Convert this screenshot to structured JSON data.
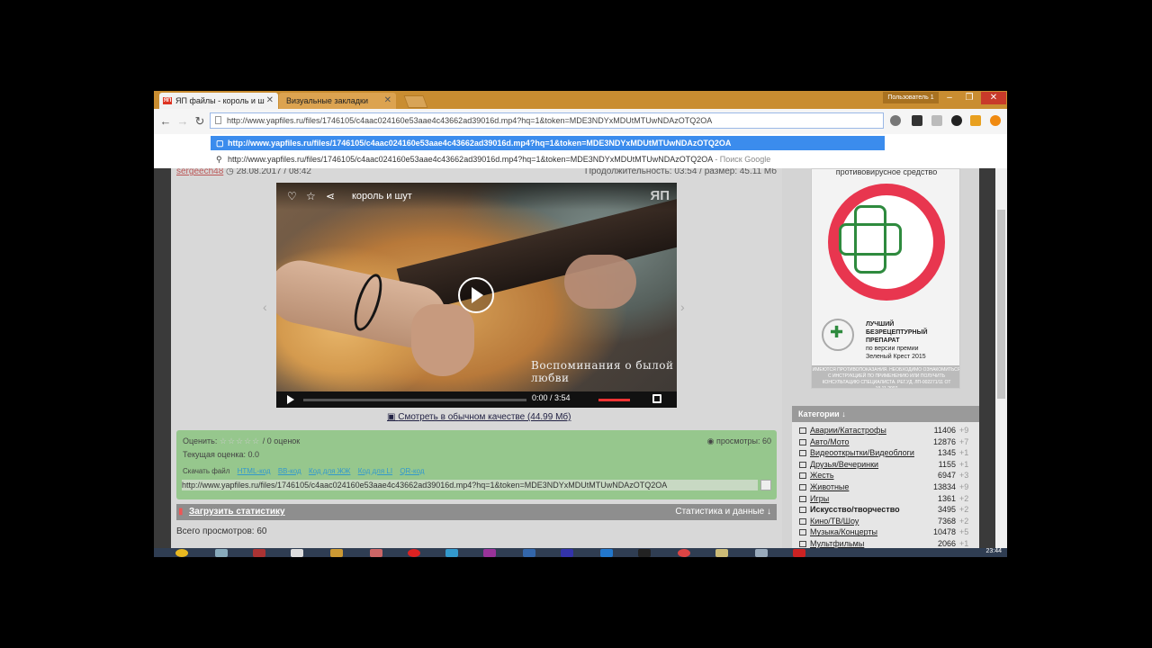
{
  "browser": {
    "tabs": [
      {
        "label": "ЯП файлы - король и ш",
        "favicon": "ЯП"
      },
      {
        "label": "Визуальные закладки"
      }
    ],
    "user_badge": "Пользователь 1",
    "window_controls": {
      "min": "–",
      "max": "❐",
      "close": "✕"
    },
    "url": "http://www.yapfiles.ru/files/1746105/c4aac024160e53aae4c43662ad39016d.mp4?hq=1&token=MDE3NDYxMDUtMTUwNDAzOTQ2OA",
    "suggestions": [
      {
        "text": "http://www.yapfiles.ru/files/1746105/c4aac024160e53aae4c43662ad39016d.mp4?hq=1&token=MDE3NDYxMDUtMTUwNDAzOTQ2OA"
      },
      {
        "text": "http://www.yapfiles.ru/files/1746105/c4aac024160e53aae4c43662ad39016d.mp4?hq=1&token=MDE3NDYxMDUtMTUwNDAzOTQ2OA",
        "suffix": " - Поиск Google"
      }
    ]
  },
  "meta": {
    "user": "sergeech48",
    "date": "28.08.2017 / 08:42",
    "duration": "Продолжительность: 03:54 / размер: 45.11 Мб"
  },
  "player": {
    "title": "король и шут",
    "logo": "ЯП",
    "subtitle": "Воспоминания о былой любви",
    "time": "0:00 / 3:54",
    "progress_fraction": 0
  },
  "hq_link": "Смотреть в обычном качестве (44.99 Мб)",
  "rating": {
    "label": "Оценить:",
    "stars": "☆☆☆☆☆",
    "count": "/ 0 оценок",
    "views": "просмотры: 60",
    "current": "Текущая оценка: 0.0",
    "download_label": "Скачать файл",
    "download_links": [
      "HTML-код",
      "BB-код",
      "Код для ЖЖ",
      "Код для LI",
      "QR-код"
    ],
    "share_url": "http://www.yapfiles.ru/files/1746105/c4aac024160e53aae4c43662ad39016d.mp4?hq=1&token=MDE3NDYxMDUtMTUwNDAzOTQ2OA"
  },
  "stats": {
    "upload": "Загрузить статистику",
    "right": "Статистика и данные ↓",
    "total": "Всего просмотров: 60"
  },
  "ad": {
    "top": "противовирусное средство",
    "line1": "ЛУЧШИЙ",
    "line2": "БЕЗРЕЦЕПТУРНЫЙ ПРЕПАРАТ",
    "line3": "по версии премии",
    "line4": "Зеленый Крест 2015",
    "small": "ИМЕЮТСЯ ПРОТИВОПОКАЗАНИЯ. НЕОБХОДИМО ОЗНАКОМИТЬСЯ С ИНСТРУКЦИЕЙ ПО ПРИМЕНЕНИЮ ИЛИ ПОЛУЧИТЬ КОНСУЛЬТАЦИЮ СПЕЦИАЛИСТА. РЕГ.УД. ЛП-002271/11 ОТ 19.11.2007"
  },
  "categories": {
    "header": "Категории ↓",
    "items": [
      {
        "name": "Аварии/Катастрофы",
        "count": "11406",
        "delta": "+9"
      },
      {
        "name": "Авто/Мото",
        "count": "12876",
        "delta": "+7"
      },
      {
        "name": "Видеооткрытки/Видеоблоги",
        "count": "1345",
        "delta": "+1"
      },
      {
        "name": "Друзья/Вечеринки",
        "count": "1155",
        "delta": "+1"
      },
      {
        "name": "Жесть",
        "count": "6947",
        "delta": "+3"
      },
      {
        "name": "Животные",
        "count": "13834",
        "delta": "+9"
      },
      {
        "name": "Игры",
        "count": "1361",
        "delta": "+2"
      },
      {
        "name": "Искусство/творчество",
        "count": "3495",
        "delta": "+2",
        "bold": true
      },
      {
        "name": "Кино/ТВ/Шоу",
        "count": "7368",
        "delta": "+2"
      },
      {
        "name": "Музыка/Концерты",
        "count": "10478",
        "delta": "+5"
      },
      {
        "name": "Мультфильмы",
        "count": "2066",
        "delta": "+1"
      }
    ]
  },
  "taskbar": {
    "clock": "23:44"
  },
  "colors": {
    "titlebar": "#c98d31",
    "accent_green": "#96c78d",
    "brand_red": "#e8364f"
  }
}
